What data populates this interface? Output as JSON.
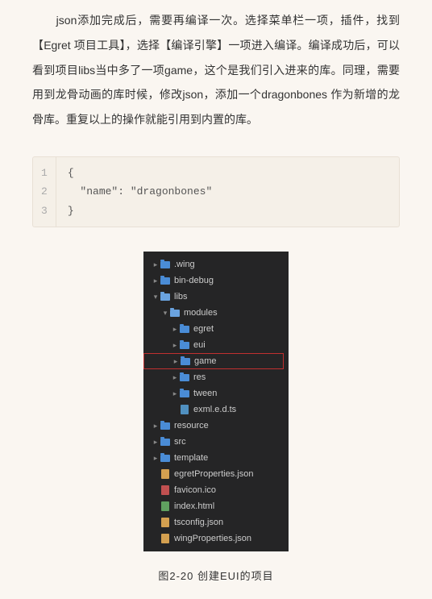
{
  "paragraph": "　　json添加完成后，需要再编译一次。选择菜单栏一项，插件，找到【Egret 项目工具】，选择【编译引擎】一项进入编译。编译成功后，可以看到项目libs当中多了一项game，这个是我们引入进来的库。同理，需要用到龙骨动画的库时候，修改json，添加一个dragonbones 作为新增的龙骨库。重复以上的操作就能引用到内置的库。",
  "code": {
    "lines": [
      "1",
      "2",
      "3"
    ],
    "content": [
      "{",
      "  \"name\": \"dragonbones\"",
      "}"
    ]
  },
  "tree": {
    "wing": ".wing",
    "bindebug": "bin-debug",
    "libs": "libs",
    "modules": "modules",
    "egret": "egret",
    "eui": "eui",
    "game": "game",
    "res": "res",
    "tween": "tween",
    "exml": "exml.e.d.ts",
    "resource": "resource",
    "src": "src",
    "template": "template",
    "egretprops": "egretProperties.json",
    "favicon": "favicon.ico",
    "index": "index.html",
    "tsconfig": "tsconfig.json",
    "wingprops": "wingProperties.json"
  },
  "caption": "图2-20 创建EUI的项目"
}
